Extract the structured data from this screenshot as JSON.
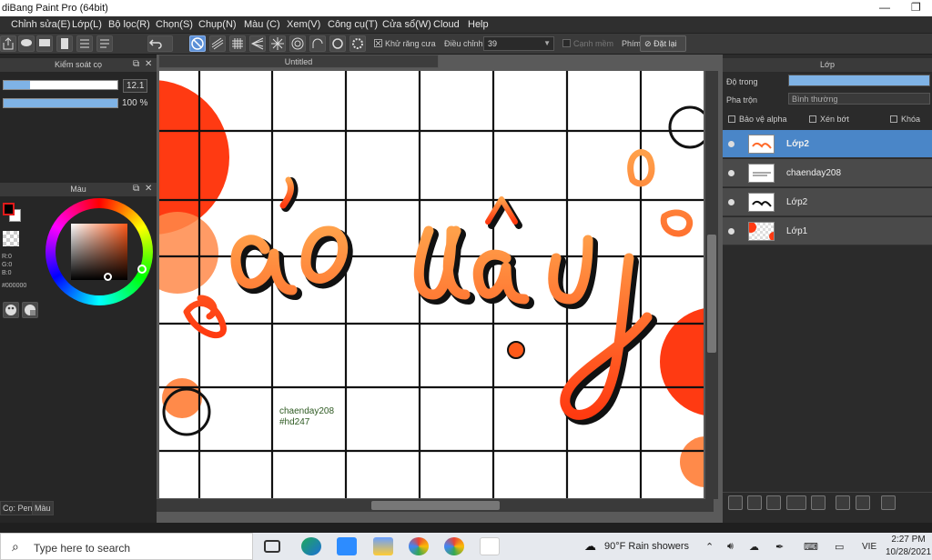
{
  "window": {
    "title": "diBang Paint Pro (64bit)",
    "restore_glyph": "❐",
    "minimize_glyph": "—"
  },
  "menu": [
    "Chỉnh sửa(E)",
    "Lớp(L)",
    "Bộ lọc(R)",
    "Chọn(S)",
    "Chụp(N)",
    "Màu (C)",
    "Xem(V)",
    "Công cụ(T)",
    "Cửa sổ(W)",
    "Cloud",
    "Help"
  ],
  "toolbar": {
    "antialias_label": "Khử răng cưa",
    "correction_label": "Điều chỉnh",
    "correction_value": "39",
    "soft_edge_label": "Cạnh mềm",
    "key_label": "Phím",
    "reset_label": "Đặt lại"
  },
  "brush_panel": {
    "title": "Kiểm soát cọ",
    "size_value": "12.1",
    "size_fraction": 0.23,
    "opacity_value": "100 %",
    "opacity_fraction": 1.0
  },
  "color_panel": {
    "title": "Màu",
    "r": "R:0",
    "g": "G:0",
    "b": "B:0",
    "hex": "#000000"
  },
  "left_tabs": [
    "Cọ: Pen",
    "Màu"
  ],
  "document": {
    "tab_title": "Untitled"
  },
  "artwork": {
    "signature_line1": "chaenday208",
    "signature_line2": "#hd247",
    "lettering": "ảo vậy"
  },
  "layers_panel": {
    "title": "Lớp",
    "opacity_label": "Độ trong",
    "blend_label": "Pha trộn",
    "blend_value": "Bình thường",
    "protect_alpha": "Bảo vệ alpha",
    "clipping": "Xén bớt",
    "lock": "Khóa",
    "layers": [
      {
        "name": "Lớp2",
        "selected": true
      },
      {
        "name": "chaenday208",
        "selected": false
      },
      {
        "name": "Lớp2",
        "selected": false
      },
      {
        "name": "Lớp1",
        "selected": false
      }
    ]
  },
  "taskbar": {
    "search_placeholder": "Type here to search",
    "weather": "90°F  Rain showers",
    "language": "VIE",
    "time": "2:27 PM",
    "date": "10/28/2021"
  },
  "colors": {
    "accent": "#4a86c8",
    "orange": "#ff6a2a",
    "red": "#ff3a12",
    "peach": "#ff8a4a"
  }
}
